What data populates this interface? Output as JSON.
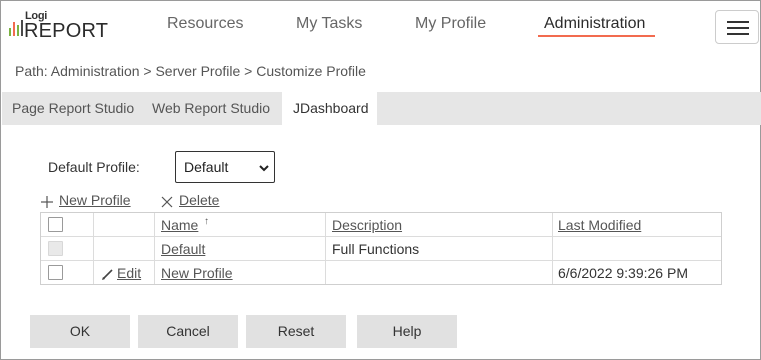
{
  "header": {
    "logo": {
      "line1": "Logi",
      "line2": "REPORT"
    },
    "nav": [
      {
        "label": "Resources"
      },
      {
        "label": "My Tasks"
      },
      {
        "label": "My Profile"
      },
      {
        "label": "Administration",
        "active": true
      }
    ],
    "menu_icon": "hamburger-icon"
  },
  "breadcrumb": "Path: Administration > Server Profile > Customize Profile",
  "tabs": [
    {
      "label": "Page Report Studio"
    },
    {
      "label": "Web Report Studio"
    },
    {
      "label": "JDashboard",
      "active": true
    }
  ],
  "default_profile": {
    "label": "Default Profile:",
    "selected": "Default"
  },
  "actions": {
    "new_profile": "New Profile",
    "delete": "Delete"
  },
  "table": {
    "columns": [
      "Name",
      "Description",
      "Last Modified"
    ],
    "sorted_column": "Name",
    "rows": [
      {
        "name": "Default",
        "description": "Full Functions",
        "last_modified": "",
        "editable": false
      },
      {
        "edit_label": "Edit",
        "name": "New Profile",
        "description": "",
        "last_modified": "6/6/2022 9:39:26 PM",
        "editable": true
      }
    ]
  },
  "buttons": {
    "ok": "OK",
    "cancel": "Cancel",
    "reset": "Reset",
    "help": "Help"
  },
  "colors": {
    "accent_underline": "#f26b4f",
    "logo_bars": [
      "#f26b4f",
      "#7cb342",
      "#4a4a4a"
    ],
    "tab_bar": "#e6e6e6",
    "button_bg": "#e1e1e1"
  }
}
